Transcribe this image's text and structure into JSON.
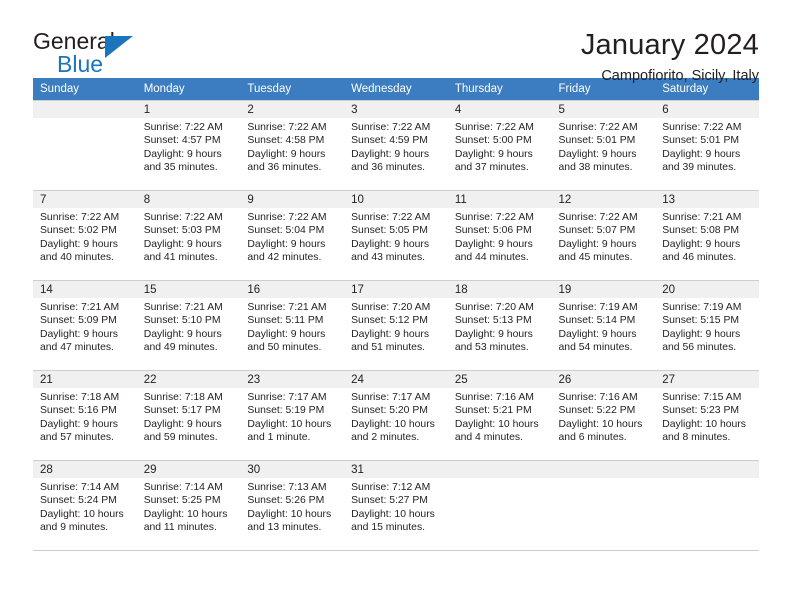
{
  "brand": {
    "name_part1": "General",
    "name_part2": "Blue"
  },
  "header": {
    "title": "January 2024",
    "subtitle": "Campofiorito, Sicily, Italy"
  },
  "weekday_headers": [
    "Sunday",
    "Monday",
    "Tuesday",
    "Wednesday",
    "Thursday",
    "Friday",
    "Saturday"
  ],
  "colors": {
    "header_blue": "#3b7dc0",
    "brand_blue": "#1b75bc",
    "shade_gray": "#f0f0f0",
    "text": "#231f20"
  },
  "weeks": [
    [
      {
        "day": "",
        "sunrise": "",
        "sunset": "",
        "daylight1": "",
        "daylight2": "",
        "empty": true
      },
      {
        "day": "1",
        "sunrise": "Sunrise: 7:22 AM",
        "sunset": "Sunset: 4:57 PM",
        "daylight1": "Daylight: 9 hours",
        "daylight2": "and 35 minutes.",
        "empty": false
      },
      {
        "day": "2",
        "sunrise": "Sunrise: 7:22 AM",
        "sunset": "Sunset: 4:58 PM",
        "daylight1": "Daylight: 9 hours",
        "daylight2": "and 36 minutes.",
        "empty": false
      },
      {
        "day": "3",
        "sunrise": "Sunrise: 7:22 AM",
        "sunset": "Sunset: 4:59 PM",
        "daylight1": "Daylight: 9 hours",
        "daylight2": "and 36 minutes.",
        "empty": false
      },
      {
        "day": "4",
        "sunrise": "Sunrise: 7:22 AM",
        "sunset": "Sunset: 5:00 PM",
        "daylight1": "Daylight: 9 hours",
        "daylight2": "and 37 minutes.",
        "empty": false
      },
      {
        "day": "5",
        "sunrise": "Sunrise: 7:22 AM",
        "sunset": "Sunset: 5:01 PM",
        "daylight1": "Daylight: 9 hours",
        "daylight2": "and 38 minutes.",
        "empty": false
      },
      {
        "day": "6",
        "sunrise": "Sunrise: 7:22 AM",
        "sunset": "Sunset: 5:01 PM",
        "daylight1": "Daylight: 9 hours",
        "daylight2": "and 39 minutes.",
        "empty": false
      }
    ],
    [
      {
        "day": "7",
        "sunrise": "Sunrise: 7:22 AM",
        "sunset": "Sunset: 5:02 PM",
        "daylight1": "Daylight: 9 hours",
        "daylight2": "and 40 minutes.",
        "empty": false
      },
      {
        "day": "8",
        "sunrise": "Sunrise: 7:22 AM",
        "sunset": "Sunset: 5:03 PM",
        "daylight1": "Daylight: 9 hours",
        "daylight2": "and 41 minutes.",
        "empty": false
      },
      {
        "day": "9",
        "sunrise": "Sunrise: 7:22 AM",
        "sunset": "Sunset: 5:04 PM",
        "daylight1": "Daylight: 9 hours",
        "daylight2": "and 42 minutes.",
        "empty": false
      },
      {
        "day": "10",
        "sunrise": "Sunrise: 7:22 AM",
        "sunset": "Sunset: 5:05 PM",
        "daylight1": "Daylight: 9 hours",
        "daylight2": "and 43 minutes.",
        "empty": false
      },
      {
        "day": "11",
        "sunrise": "Sunrise: 7:22 AM",
        "sunset": "Sunset: 5:06 PM",
        "daylight1": "Daylight: 9 hours",
        "daylight2": "and 44 minutes.",
        "empty": false
      },
      {
        "day": "12",
        "sunrise": "Sunrise: 7:22 AM",
        "sunset": "Sunset: 5:07 PM",
        "daylight1": "Daylight: 9 hours",
        "daylight2": "and 45 minutes.",
        "empty": false
      },
      {
        "day": "13",
        "sunrise": "Sunrise: 7:21 AM",
        "sunset": "Sunset: 5:08 PM",
        "daylight1": "Daylight: 9 hours",
        "daylight2": "and 46 minutes.",
        "empty": false
      }
    ],
    [
      {
        "day": "14",
        "sunrise": "Sunrise: 7:21 AM",
        "sunset": "Sunset: 5:09 PM",
        "daylight1": "Daylight: 9 hours",
        "daylight2": "and 47 minutes.",
        "empty": false
      },
      {
        "day": "15",
        "sunrise": "Sunrise: 7:21 AM",
        "sunset": "Sunset: 5:10 PM",
        "daylight1": "Daylight: 9 hours",
        "daylight2": "and 49 minutes.",
        "empty": false
      },
      {
        "day": "16",
        "sunrise": "Sunrise: 7:21 AM",
        "sunset": "Sunset: 5:11 PM",
        "daylight1": "Daylight: 9 hours",
        "daylight2": "and 50 minutes.",
        "empty": false
      },
      {
        "day": "17",
        "sunrise": "Sunrise: 7:20 AM",
        "sunset": "Sunset: 5:12 PM",
        "daylight1": "Daylight: 9 hours",
        "daylight2": "and 51 minutes.",
        "empty": false
      },
      {
        "day": "18",
        "sunrise": "Sunrise: 7:20 AM",
        "sunset": "Sunset: 5:13 PM",
        "daylight1": "Daylight: 9 hours",
        "daylight2": "and 53 minutes.",
        "empty": false
      },
      {
        "day": "19",
        "sunrise": "Sunrise: 7:19 AM",
        "sunset": "Sunset: 5:14 PM",
        "daylight1": "Daylight: 9 hours",
        "daylight2": "and 54 minutes.",
        "empty": false
      },
      {
        "day": "20",
        "sunrise": "Sunrise: 7:19 AM",
        "sunset": "Sunset: 5:15 PM",
        "daylight1": "Daylight: 9 hours",
        "daylight2": "and 56 minutes.",
        "empty": false
      }
    ],
    [
      {
        "day": "21",
        "sunrise": "Sunrise: 7:18 AM",
        "sunset": "Sunset: 5:16 PM",
        "daylight1": "Daylight: 9 hours",
        "daylight2": "and 57 minutes.",
        "empty": false
      },
      {
        "day": "22",
        "sunrise": "Sunrise: 7:18 AM",
        "sunset": "Sunset: 5:17 PM",
        "daylight1": "Daylight: 9 hours",
        "daylight2": "and 59 minutes.",
        "empty": false
      },
      {
        "day": "23",
        "sunrise": "Sunrise: 7:17 AM",
        "sunset": "Sunset: 5:19 PM",
        "daylight1": "Daylight: 10 hours",
        "daylight2": "and 1 minute.",
        "empty": false
      },
      {
        "day": "24",
        "sunrise": "Sunrise: 7:17 AM",
        "sunset": "Sunset: 5:20 PM",
        "daylight1": "Daylight: 10 hours",
        "daylight2": "and 2 minutes.",
        "empty": false
      },
      {
        "day": "25",
        "sunrise": "Sunrise: 7:16 AM",
        "sunset": "Sunset: 5:21 PM",
        "daylight1": "Daylight: 10 hours",
        "daylight2": "and 4 minutes.",
        "empty": false
      },
      {
        "day": "26",
        "sunrise": "Sunrise: 7:16 AM",
        "sunset": "Sunset: 5:22 PM",
        "daylight1": "Daylight: 10 hours",
        "daylight2": "and 6 minutes.",
        "empty": false
      },
      {
        "day": "27",
        "sunrise": "Sunrise: 7:15 AM",
        "sunset": "Sunset: 5:23 PM",
        "daylight1": "Daylight: 10 hours",
        "daylight2": "and 8 minutes.",
        "empty": false
      }
    ],
    [
      {
        "day": "28",
        "sunrise": "Sunrise: 7:14 AM",
        "sunset": "Sunset: 5:24 PM",
        "daylight1": "Daylight: 10 hours",
        "daylight2": "and 9 minutes.",
        "empty": false
      },
      {
        "day": "29",
        "sunrise": "Sunrise: 7:14 AM",
        "sunset": "Sunset: 5:25 PM",
        "daylight1": "Daylight: 10 hours",
        "daylight2": "and 11 minutes.",
        "empty": false
      },
      {
        "day": "30",
        "sunrise": "Sunrise: 7:13 AM",
        "sunset": "Sunset: 5:26 PM",
        "daylight1": "Daylight: 10 hours",
        "daylight2": "and 13 minutes.",
        "empty": false
      },
      {
        "day": "31",
        "sunrise": "Sunrise: 7:12 AM",
        "sunset": "Sunset: 5:27 PM",
        "daylight1": "Daylight: 10 hours",
        "daylight2": "and 15 minutes.",
        "empty": false
      },
      {
        "day": "",
        "sunrise": "",
        "sunset": "",
        "daylight1": "",
        "daylight2": "",
        "empty": true
      },
      {
        "day": "",
        "sunrise": "",
        "sunset": "",
        "daylight1": "",
        "daylight2": "",
        "empty": true
      },
      {
        "day": "",
        "sunrise": "",
        "sunset": "",
        "daylight1": "",
        "daylight2": "",
        "empty": true
      }
    ]
  ]
}
